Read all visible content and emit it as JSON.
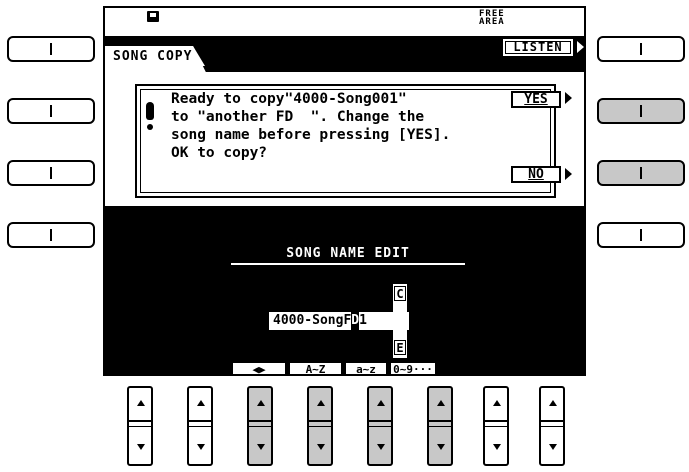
{
  "header": {
    "free_area": [
      "FREE",
      "AREA"
    ],
    "title": "SONG COPY",
    "listen_label": "LISTEN"
  },
  "dialog": {
    "lines": [
      "Ready to copy\"4000-Song001\"",
      "to \"another FD  \". Change the",
      "song name before pressing [YES].",
      "OK to copy?"
    ],
    "yes_label": "YES",
    "no_label": "NO"
  },
  "song_name_edit": {
    "title": "SONG NAME EDIT",
    "name_prefix": "4000-SongF",
    "cursor_char": "D",
    "name_suffix": "1",
    "char_above": "C",
    "char_below": "E"
  },
  "bottom_tabs": [
    "◀▶",
    "A~Z",
    "a~z",
    "0~9···"
  ],
  "icons": {
    "disk": "floppy-disk-icon",
    "warning": "exclamation-icon"
  },
  "colors": {
    "screen_bg": "#ffffff",
    "ink": "#000000",
    "active_button": "#c8c8c8"
  }
}
